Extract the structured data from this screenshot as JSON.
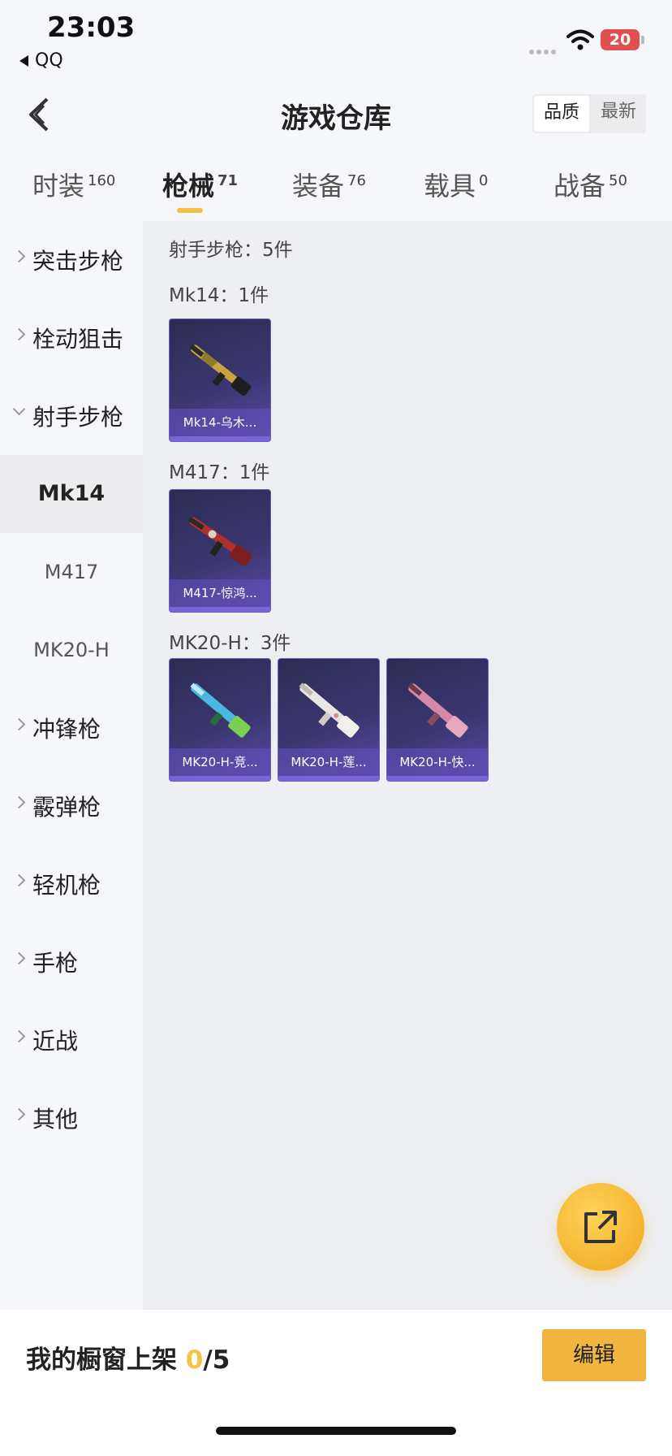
{
  "status_bar": {
    "time": "23:03",
    "back_app": "QQ",
    "battery": "20"
  },
  "header": {
    "title": "游戏仓库",
    "sort_options": [
      "品质",
      "最新"
    ],
    "active_sort": "品质"
  },
  "tabs": [
    {
      "label": "时装",
      "count": "160"
    },
    {
      "label": "枪械",
      "count": "71",
      "active": true
    },
    {
      "label": "装备",
      "count": "76"
    },
    {
      "label": "载具",
      "count": "0"
    },
    {
      "label": "战备",
      "count": "50"
    }
  ],
  "sidebar": {
    "categories": [
      "突击步枪",
      "栓动狙击",
      "射手步枪",
      "冲锋枪",
      "霰弹枪",
      "轻机枪",
      "手枪",
      "近战",
      "其他"
    ],
    "expanded": "射手步枪",
    "subitems": [
      "Mk14",
      "M417",
      "MK20-H"
    ],
    "active_subitem": "Mk14"
  },
  "content": {
    "section_title": "射手步枪：5件",
    "groups": [
      {
        "title": "Mk14：1件",
        "items": [
          "Mk14-乌木..."
        ]
      },
      {
        "title": "M417：1件",
        "items": [
          "M417-惊鸿..."
        ]
      },
      {
        "title": "MK20-H：3件",
        "items": [
          "MK20-H-竞...",
          "MK20-H-莲...",
          "MK20-H-快..."
        ]
      }
    ]
  },
  "bottom_bar": {
    "shelf_label": "我的橱窗上架",
    "shelf_count": "0",
    "shelf_total": "/5",
    "edit_label": "编辑"
  },
  "colors": {
    "accent": "#f2b540",
    "card_bg": "#3b3670",
    "shelf_count": "#f3c246"
  }
}
